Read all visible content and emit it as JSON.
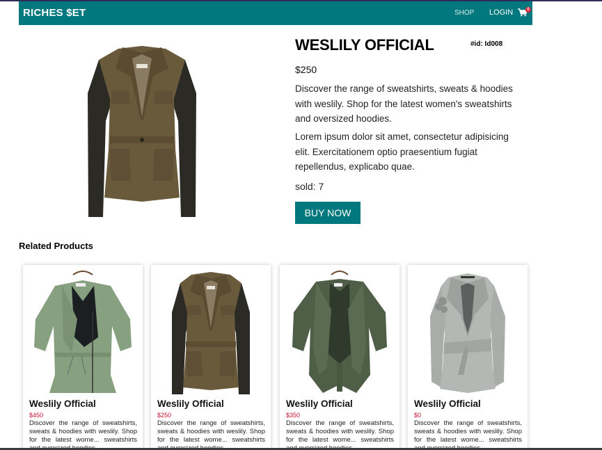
{
  "navbar": {
    "brand": "RICHES $ET",
    "shop_label": "SHOP",
    "login_label": "LOGIN",
    "cart_icon": "shopping-cart-icon",
    "cart_count": "0",
    "color": "#00787d"
  },
  "product": {
    "title": "WESLILY OFFICIAL",
    "id_label": "#id: Id008",
    "price": "$250",
    "description_1": "Discover the range of sweatshirts, sweats & hoodies with weslily. Shop for the latest women's sweatshirts and oversized hoodies.",
    "description_2": "Lorem ipsum dolor sit amet, consectetur adipisicing elit. Exercitationem optio praesentium fugiat repellendus, explicabo quae.",
    "sold": "sold: 7",
    "buy_label": "BUY NOW",
    "image": "olive-military-jacket-with-leather-sleeves"
  },
  "related": {
    "heading": "Related Products",
    "items": [
      {
        "title": "Weslily Official",
        "price": "$450",
        "description": "Discover the range of sweatshirts, sweats & hoodies with weslily. Shop for the latest wome... sweatshirts and oversized hoodies.",
        "image": "sage-green-zip-jacket"
      },
      {
        "title": "Weslily Official",
        "price": "$250",
        "description": "Discover the range of sweatshirts, sweats & hoodies with weslily. Shop for the latest wome... sweatshirts and oversized hoodies.",
        "image": "olive-military-jacket-with-leather-sleeves"
      },
      {
        "title": "Weslily Official",
        "price": "$350",
        "description": "Discover the range of sweatshirts, sweats & hoodies with weslily. Shop for the latest wome... sweatshirts and oversized hoodies.",
        "image": "dark-green-drape-jacket"
      },
      {
        "title": "Weslily Official",
        "price": "$0",
        "description": "Discover the range of sweatshirts, sweats & hoodies with weslily. Shop for the latest wome... sweatshirts and oversized hoodies.",
        "image": "grey-wrap-jacket"
      }
    ]
  }
}
